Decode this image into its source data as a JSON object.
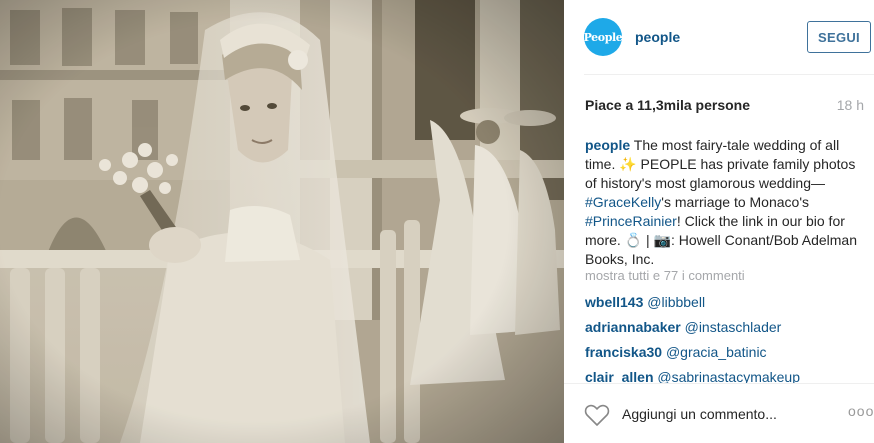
{
  "account": {
    "username": "people",
    "avatar_text": "People",
    "follow_label": "SEGUI"
  },
  "stats": {
    "likes": "Piace a 11,3mila persone",
    "time": "18 h"
  },
  "caption": {
    "user": "people",
    "text_1": " The most fairy-tale wedding of all time. ",
    "sparkle": "✨",
    "text_2": " PEOPLE has private family photos of history's most glamorous wedding—",
    "tag_1": "#GraceKelly",
    "text_3": "'s marriage to Monaco's ",
    "tag_2": "#PrinceRainier",
    "text_4": "! Click the link in our bio for more. ",
    "ring": "💍",
    "text_5": " | ",
    "camera": "📷",
    "text_6": ": Howell Conant/Bob Adelman Books, Inc."
  },
  "more_comments": "mostra tutti e 77 i commenti",
  "comments": [
    {
      "user": "wbell143",
      "mention": "@libbbell"
    },
    {
      "user": "adriannabaker",
      "mention": "@instaschlader"
    },
    {
      "user": "franciska30",
      "mention": "@gracia_batinic"
    },
    {
      "user": "clair_allen",
      "mention": "@sabrinastacymakeup"
    }
  ],
  "footer": {
    "placeholder": "Aggiungi un commento...",
    "more_options": "ooo",
    "icons": [
      "heart-icon",
      "more-options-icon"
    ]
  },
  "colors": {
    "link": "#125688",
    "follow": "#3f729b",
    "muted": "#a5a7aa",
    "avatar": "#1ea9e8"
  }
}
